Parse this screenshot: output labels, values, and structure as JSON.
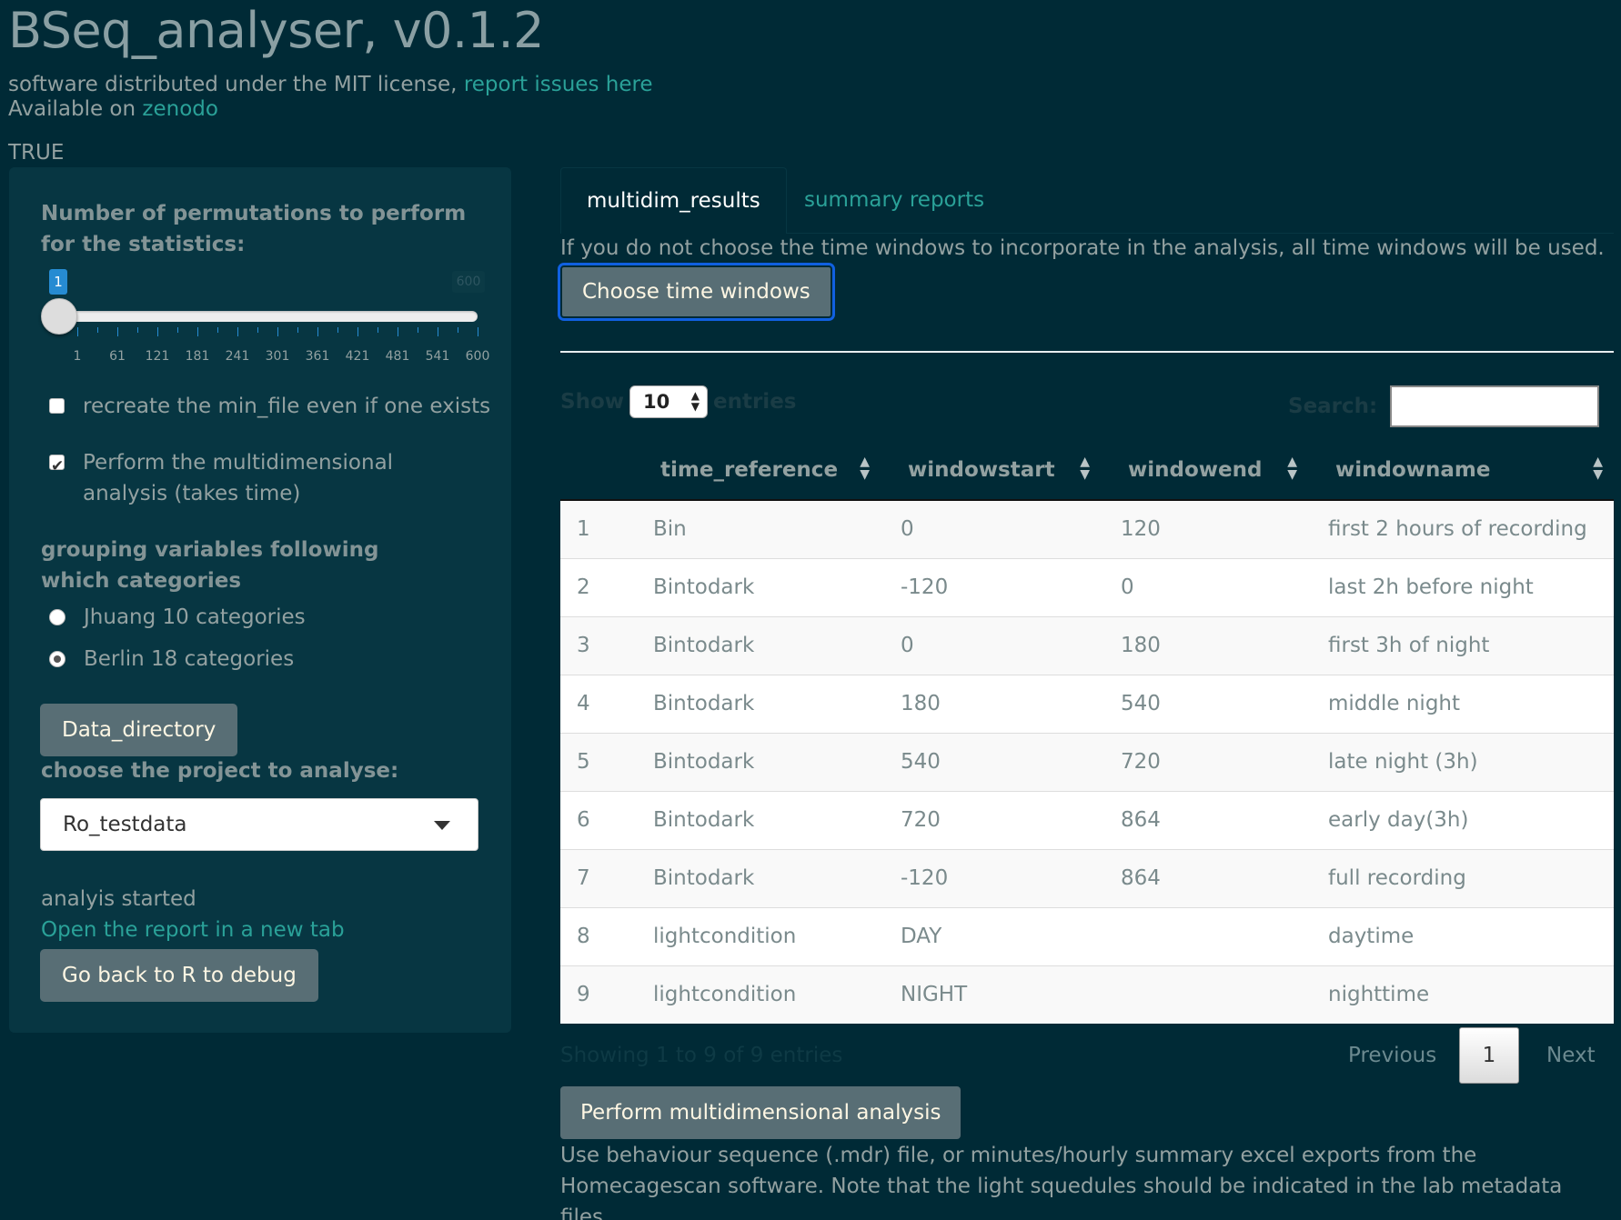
{
  "header": {
    "title": "BSeq_analyser, v0.1.2",
    "license_text": "software distributed under the MIT license, ",
    "issues_link": "report issues here",
    "available_text": "Available on ",
    "zenodo_link": "zenodo",
    "flag": "TRUE"
  },
  "sidebar": {
    "permutations_label": "Number of permutations to perform for the statistics:",
    "slider": {
      "value": "1",
      "max": "600",
      "ticks": [
        "1",
        "61",
        "121",
        "181",
        "241",
        "301",
        "361",
        "421",
        "481",
        "541",
        "600"
      ]
    },
    "recreate_checkbox": {
      "label": "recreate the min_file even if one exists",
      "checked": false
    },
    "multidim_checkbox": {
      "label": "Perform the multidimensional analysis (takes time)",
      "checked": true
    },
    "grouping_label": "grouping variables following which categories",
    "radio_options": [
      {
        "label": "Jhuang 10 categories",
        "checked": false
      },
      {
        "label": "Berlin 18 categories",
        "checked": true
      }
    ],
    "data_directory_button": "Data_directory",
    "project_label": "choose the project to analyse:",
    "project_selected": "Ro_testdata",
    "status": "analyis started",
    "report_link": "Open the report in a new tab",
    "debug_button": "Go back to R to debug"
  },
  "main": {
    "tabs": [
      {
        "label": "multidim_results",
        "active": true
      },
      {
        "label": "summary reports",
        "active": false
      }
    ],
    "hint": "If you do not choose the time windows to incorporate in the analysis, all time windows will be used.",
    "choose_button": "Choose time windows",
    "table": {
      "show_label": "Show",
      "length_value": "10",
      "entries_label": "entries",
      "search_label": "Search:",
      "columns": [
        "time_reference",
        "windowstart",
        "windowend",
        "windowname"
      ],
      "rows": [
        [
          "1",
          "Bin",
          "0",
          "120",
          "first 2 hours of recording"
        ],
        [
          "2",
          "Bintodark",
          "-120",
          "0",
          "last 2h before night"
        ],
        [
          "3",
          "Bintodark",
          "0",
          "180",
          "first 3h of night"
        ],
        [
          "4",
          "Bintodark",
          "180",
          "540",
          "middle night"
        ],
        [
          "5",
          "Bintodark",
          "540",
          "720",
          "late night (3h)"
        ],
        [
          "6",
          "Bintodark",
          "720",
          "864",
          "early day(3h)"
        ],
        [
          "7",
          "Bintodark",
          "-120",
          "864",
          "full recording"
        ],
        [
          "8",
          "lightcondition",
          "DAY",
          "",
          "daytime"
        ],
        [
          "9",
          "lightcondition",
          "NIGHT",
          "",
          "nighttime"
        ]
      ],
      "info": "Showing 1 to 9 of 9 entries",
      "previous": "Previous",
      "page": "1",
      "next": "Next"
    },
    "perform_button": "Perform multidimensional analysis",
    "footer_note": "Use behaviour sequence (.mdr) file, or minutes/hourly summary excel exports from the Homecagescan software. Note that the light squedules should be indicated in the lab metadata files."
  }
}
